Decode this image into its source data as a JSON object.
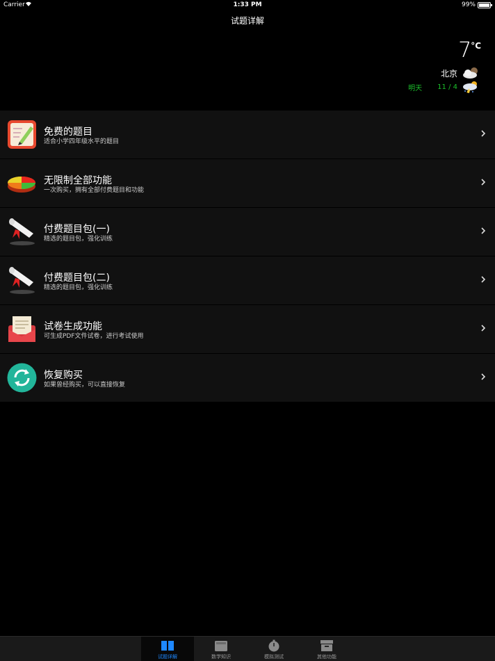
{
  "status_bar": {
    "carrier": "Carrier",
    "time": "1:33 PM",
    "battery": "99%"
  },
  "nav": {
    "title": "试题详解"
  },
  "weather": {
    "temperature": "7",
    "unit": "°C",
    "city": "北京",
    "forecast_label": "明天",
    "forecast_date": "11 / 4"
  },
  "items": [
    {
      "title": "免费的题目",
      "subtitle": "适合小学四年级水平的题目",
      "icon": "notebook-pencil-icon"
    },
    {
      "title": "无限制全部功能",
      "subtitle": "一次购买，拥有全部付费题目和功能",
      "icon": "pie-chart-icon"
    },
    {
      "title": "付费题目包(一)",
      "subtitle": "精选的题目包，强化训练",
      "icon": "diploma-scroll-icon"
    },
    {
      "title": "付费题目包(二)",
      "subtitle": "精选的题目包，强化训练",
      "icon": "diploma-scroll-icon"
    },
    {
      "title": "试卷生成功能",
      "subtitle": "可生成PDF文件试卷，进行考试使用",
      "icon": "envelope-letter-icon"
    },
    {
      "title": "恢复购买",
      "subtitle": "如果曾经购买，可以直接恢复",
      "icon": "refresh-icon"
    }
  ],
  "tabs": [
    {
      "label": "试题详解",
      "active": true
    },
    {
      "label": "数学知识",
      "active": false
    },
    {
      "label": "模拟测试",
      "active": false
    },
    {
      "label": "其他功能",
      "active": false
    }
  ],
  "colors": {
    "accent": "#1e88ff",
    "forecast": "#1bbf2b",
    "row_bg": "#111111"
  }
}
